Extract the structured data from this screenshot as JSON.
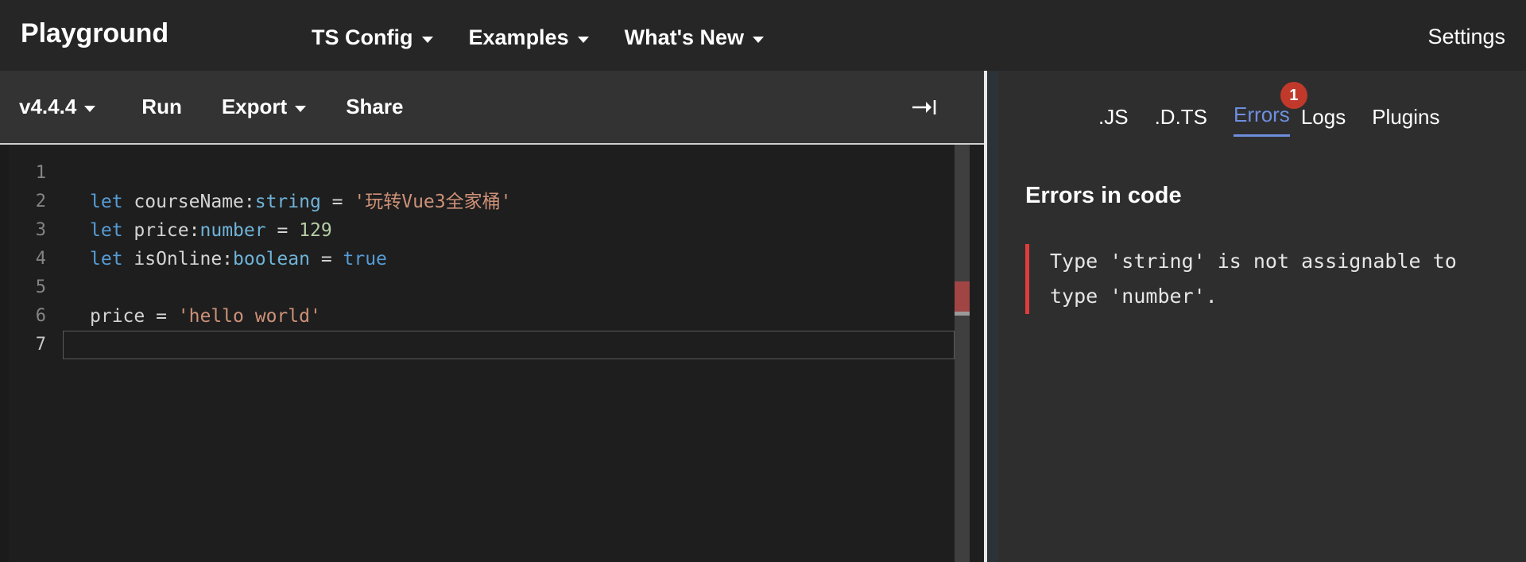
{
  "navbar": {
    "brand": "Playground",
    "items": [
      {
        "label": "TS Config",
        "icon": "chevron-down-icon"
      },
      {
        "label": "Examples",
        "icon": "chevron-down-icon"
      },
      {
        "label": "What's New",
        "icon": "chevron-down-icon"
      }
    ],
    "settings_label": "Settings"
  },
  "toolbar": {
    "version_label": "v4.4.4",
    "run_label": "Run",
    "export_label": "Export",
    "share_label": "Share",
    "sidebar_toggle_icon": "arrow-to-line-right-icon"
  },
  "editor": {
    "line_numbers": [
      "1",
      "2",
      "3",
      "4",
      "5",
      "6",
      "7"
    ],
    "active_line": 7,
    "lines": [
      {
        "n": "1",
        "tokens": []
      },
      {
        "n": "2",
        "tokens": [
          {
            "t": "let",
            "c": "kw"
          },
          {
            "t": " courseName",
            "c": "var"
          },
          {
            "t": ":",
            "c": "op"
          },
          {
            "t": "string",
            "c": "type-b"
          },
          {
            "t": " = ",
            "c": "op"
          },
          {
            "t": "'玩转Vue3全家桶'",
            "c": "str"
          }
        ]
      },
      {
        "n": "3",
        "tokens": [
          {
            "t": "let",
            "c": "kw"
          },
          {
            "t": " price",
            "c": "var"
          },
          {
            "t": ":",
            "c": "op"
          },
          {
            "t": "number",
            "c": "type-b"
          },
          {
            "t": " = ",
            "c": "op"
          },
          {
            "t": "129",
            "c": "num"
          }
        ]
      },
      {
        "n": "4",
        "tokens": [
          {
            "t": "let",
            "c": "kw"
          },
          {
            "t": " isOnline",
            "c": "var"
          },
          {
            "t": ":",
            "c": "op"
          },
          {
            "t": "boolean",
            "c": "type-b"
          },
          {
            "t": " = ",
            "c": "op"
          },
          {
            "t": "true",
            "c": "bool"
          }
        ]
      },
      {
        "n": "5",
        "tokens": []
      },
      {
        "n": "6",
        "tokens": [
          {
            "t": "price",
            "c": "var",
            "error": true
          },
          {
            "t": " = ",
            "c": "op"
          },
          {
            "t": "'hello world'",
            "c": "str"
          }
        ]
      },
      {
        "n": "7",
        "tokens": []
      }
    ],
    "error_marker_color": "#a04444"
  },
  "panel": {
    "tabs": [
      {
        "label": ".JS",
        "active": false,
        "badge": null
      },
      {
        "label": ".D.TS",
        "active": false,
        "badge": null
      },
      {
        "label": "Errors",
        "active": true,
        "badge": "1"
      },
      {
        "label": "Logs",
        "active": false,
        "badge": null
      },
      {
        "label": "Plugins",
        "active": false,
        "badge": null
      }
    ],
    "heading": "Errors in code",
    "errors": [
      {
        "message": "Type 'string' is not assignable to\ntype 'number'."
      }
    ]
  },
  "colors": {
    "accent_blue": "#6e8fe0",
    "badge_red": "#c0392b",
    "error_bar_red": "#e03c3c",
    "navbar_bg": "#262626",
    "toolbar_bg": "#333333",
    "editor_bg": "#1e1e1e",
    "panel_bg": "#2e2e2e"
  }
}
